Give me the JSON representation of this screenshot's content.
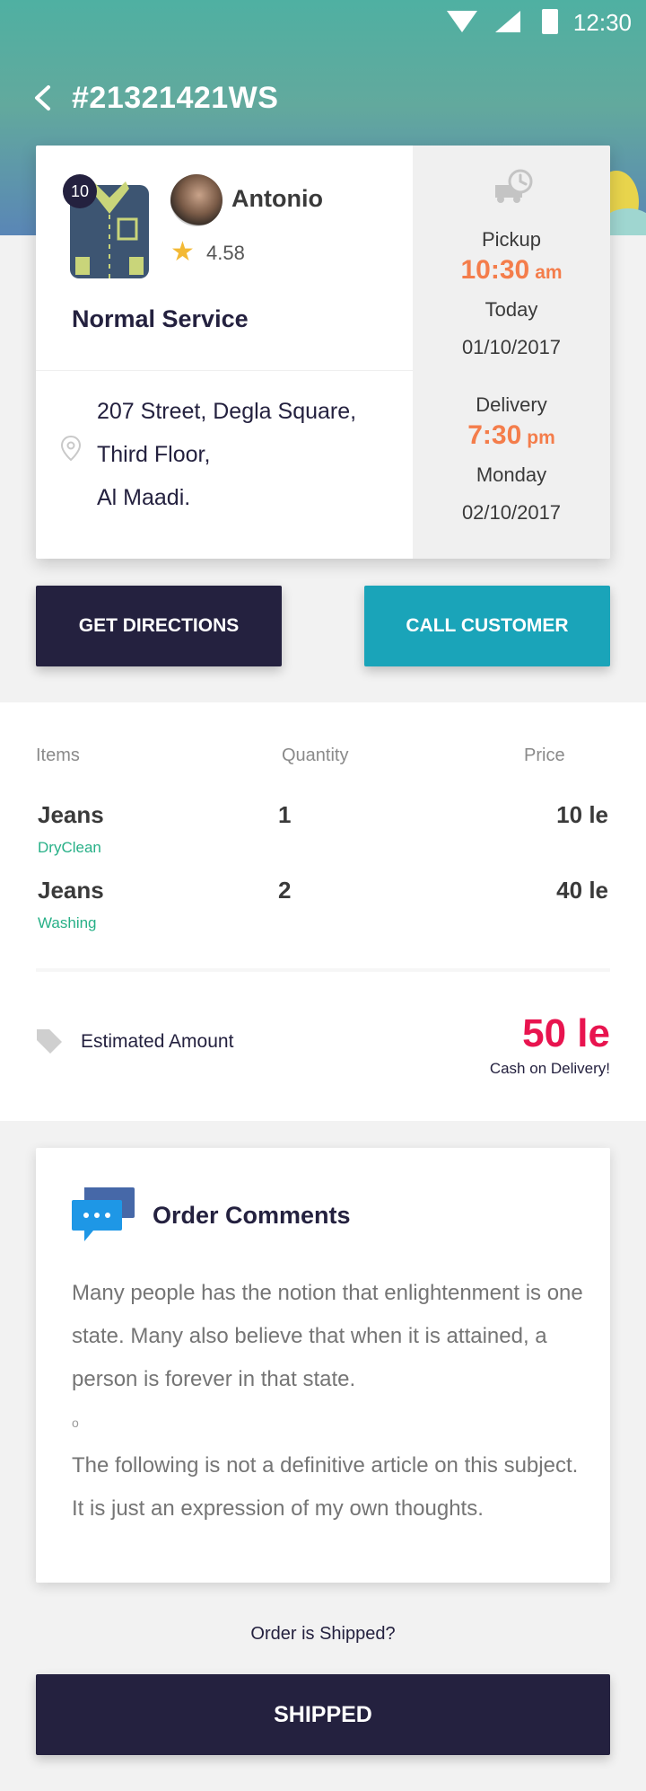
{
  "status_bar": {
    "time": "12:30"
  },
  "header": {
    "order_id": "#21321421WS"
  },
  "order": {
    "item_count": "10",
    "customer_name": "Antonio",
    "rating": "4.58",
    "service_type": "Normal Service",
    "address_lines": [
      "207 Street, Degla Square,",
      "Third Floor,",
      "Al Maadi."
    ],
    "pickup": {
      "label": "Pickup",
      "time": "10:30",
      "period": "am",
      "day": "Today",
      "date": "01/10/2017"
    },
    "delivery": {
      "label": "Delivery",
      "time": "7:30",
      "period": "pm",
      "day": "Monday",
      "date": "02/10/2017"
    }
  },
  "actions": {
    "directions_label": "GET DIRECTIONS",
    "call_label": "CALL CUSTOMER"
  },
  "items_table": {
    "headers": [
      "Items",
      "Quantity",
      "Price"
    ],
    "rows": [
      {
        "name": "Jeans",
        "service": "DryClean",
        "quantity": "1",
        "price": "10 le"
      },
      {
        "name": "Jeans",
        "service": "Washing",
        "quantity": "2",
        "price": "40 le"
      }
    ]
  },
  "estimate": {
    "label": "Estimated Amount",
    "amount": "50 le",
    "payment": "Cash on Delivery!"
  },
  "comments": {
    "title": "Order Comments",
    "paragraph1": "Many people has the notion that enlightenment is one state. Many also believe that when it is attained, a person is forever in that state.",
    "bullet": "o",
    "paragraph2": "The following is not a definitive article on this subject. It is just an expression of my own thoughts."
  },
  "footer": {
    "question": "Order is Shipped?",
    "shipped_label": "SHIPPED"
  },
  "colors": {
    "navy": "#24213f",
    "teal": "#1aa4b9",
    "accent_orange": "#f47d4b",
    "accent_red": "#e8144f",
    "green": "#27b087"
  }
}
